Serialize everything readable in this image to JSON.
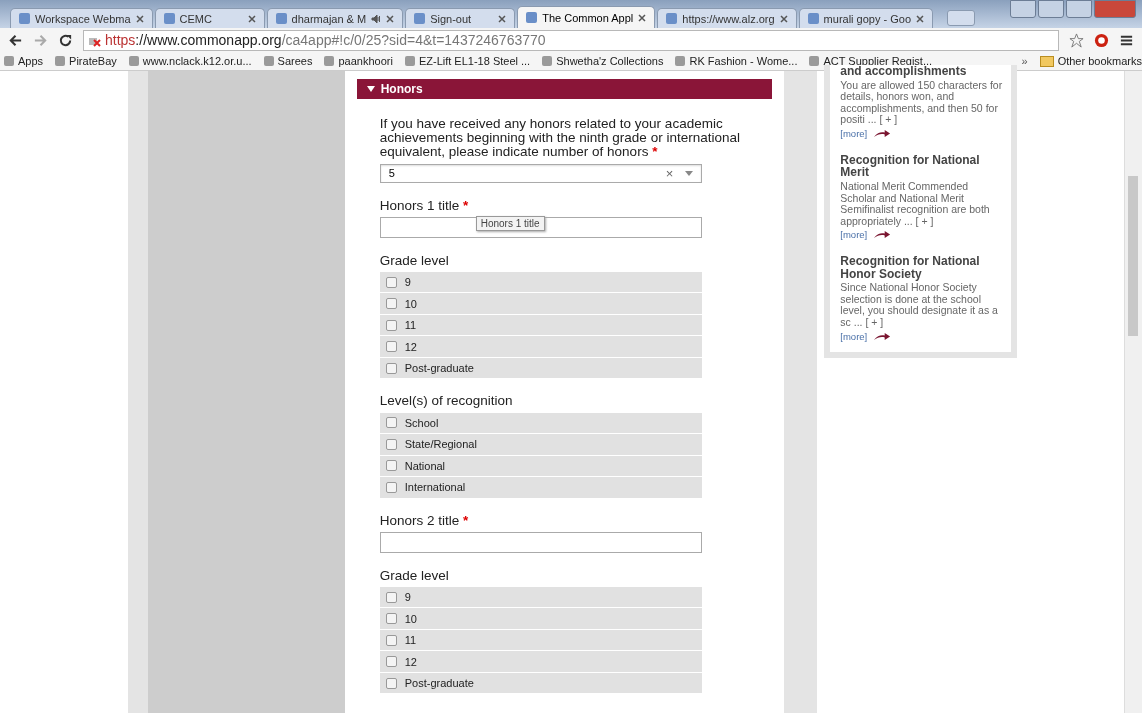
{
  "tabs": [
    {
      "label": "Workspace Webma",
      "selected": false,
      "audio": false
    },
    {
      "label": "CEMC",
      "selected": false,
      "audio": false
    },
    {
      "label": "dharmajan & M",
      "selected": false,
      "audio": true
    },
    {
      "label": "Sign-out",
      "selected": false,
      "audio": false
    },
    {
      "label": "The Common Appl",
      "selected": true,
      "audio": false
    },
    {
      "label": "https://www.alz.org",
      "selected": false,
      "audio": false
    },
    {
      "label": "murali gopy - Goo",
      "selected": false,
      "audio": false
    }
  ],
  "address": {
    "scheme": "https",
    "host": "://www.commonapp.org",
    "path": "/ca4app#!c/0/25?sid=4&t=1437246763770"
  },
  "bookmarks": {
    "items": [
      "Apps",
      "PirateBay",
      "www.nclack.k12.or.u...",
      "Sarees",
      "paankhoori",
      "EZ-Lift EL1-18 Steel ...",
      "Shwetha'z Collections",
      "RK Fashion - Wome...",
      "ACT Supplier Regist..."
    ],
    "more": "»",
    "other": "Other bookmarks"
  },
  "section": {
    "title": "Honors",
    "expanded": true,
    "fields": [
      {
        "kind": "select",
        "label": "If you have received any honors related to your academic achievements beginning with the ninth grade or international equivalent, please indicate number of honors",
        "required": "*",
        "value": "5",
        "clear": "×"
      },
      {
        "kind": "text",
        "label": "Honors 1 title",
        "required": "*",
        "tooltip": "Honors 1 title"
      },
      {
        "kind": "checks",
        "label": "Grade level",
        "options": [
          {
            "label": "9",
            "checked": false
          },
          {
            "label": "10",
            "checked": false
          },
          {
            "label": "11",
            "checked": false
          },
          {
            "label": "12",
            "checked": false
          },
          {
            "label": "Post-graduate",
            "checked": false
          }
        ]
      },
      {
        "kind": "checks",
        "label": "Level(s) of recognition",
        "options": [
          {
            "label": "School",
            "checked": false
          },
          {
            "label": "State/Regional",
            "checked": false
          },
          {
            "label": "National",
            "checked": false
          },
          {
            "label": "International",
            "checked": false
          }
        ]
      },
      {
        "kind": "text",
        "label": "Honors 2 title",
        "required": "*"
      },
      {
        "kind": "checks",
        "label": "Grade level",
        "options": [
          {
            "label": "9",
            "checked": false
          },
          {
            "label": "10",
            "checked": false
          },
          {
            "label": "11",
            "checked": false
          },
          {
            "label": "12",
            "checked": false
          },
          {
            "label": "Post-graduate",
            "checked": false
          }
        ]
      }
    ]
  },
  "tips": [
    {
      "title": "and accomplishments",
      "body": "You are allowed 150 characters for details, honors won, and accomplishments, and then 50 for positi ... [ + ]",
      "more": "[more]"
    },
    {
      "title": "Recognition for National Merit",
      "body": "National Merit Commended Scholar and National Merit Semifinalist recognition are both appropriately ... [ + ]",
      "more": "[more]"
    },
    {
      "title": "Recognition for National Honor Society",
      "body": "Since National Honor Society selection is done at the school level, you should designate it as a sc ... [ + ]",
      "more": "[more]"
    }
  ]
}
